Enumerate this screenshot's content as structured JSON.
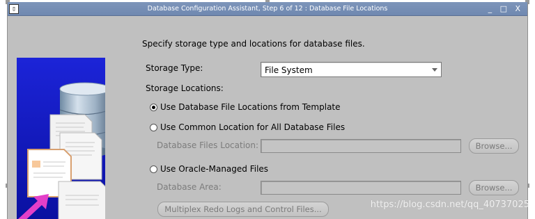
{
  "window": {
    "title": "Database Configuration Assistant, Step 6 of 12 : Database File Locations",
    "controls": "_ □ X",
    "icon_glyph": "▯"
  },
  "main": {
    "heading": "Specify storage type and locations for database files.",
    "storage_type_label": "Storage Type:",
    "storage_type_value": "File System",
    "storage_locations_label": "Storage Locations:",
    "options": [
      {
        "label": "Use Database File Locations from Template",
        "selected": true
      },
      {
        "label": "Use Common Location for All Database Files",
        "selected": false
      },
      {
        "label": "Use Oracle-Managed Files",
        "selected": false
      }
    ],
    "db_files_location_label": "Database Files Location:",
    "db_files_location_value": "",
    "database_area_label": "Database Area:",
    "database_area_value": "",
    "browse_label": "Browse...",
    "multiplex_label": "Multiplex Redo Logs and Control Files..."
  },
  "watermark": "https://blog.csdn.net/qq_40737025",
  "colors": {
    "window_bg": "#c0c0c0",
    "titlebar": "#7d95ba",
    "art_bg": "#1c24d8",
    "disabled_text": "#7c7c7c"
  }
}
